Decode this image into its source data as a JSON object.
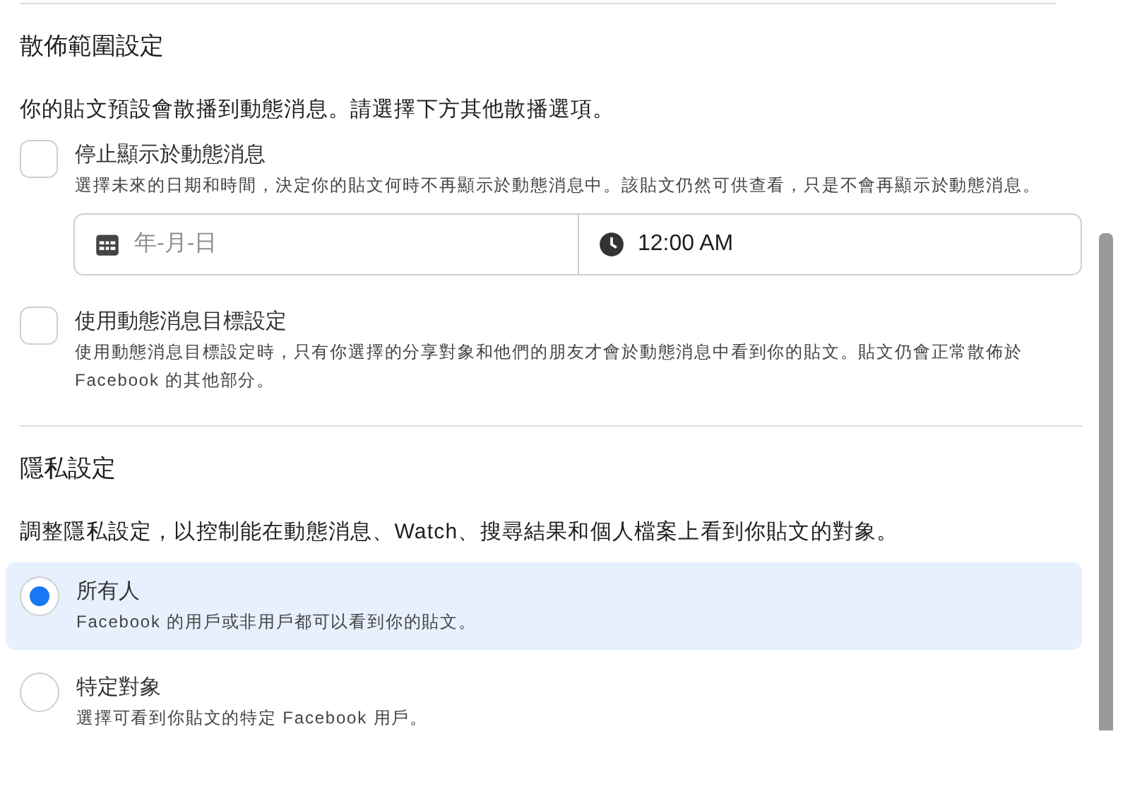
{
  "distribution": {
    "title": "散佈範圍設定",
    "description": "你的貼文預設會散播到動態消息。請選擇下方其他散播選項。",
    "options": [
      {
        "kind": "schedule",
        "label": "停止顯示於動態消息",
        "description": "選擇未來的日期和時間，決定你的貼文何時不再顯示於動態消息中。該貼文仍然可供查看，只是不會再顯示於動態消息。",
        "checked": false,
        "date_placeholder": "年-月-日",
        "time_value": "12:00 AM"
      },
      {
        "kind": "plain",
        "label": "使用動態消息目標設定",
        "description": "使用動態消息目標設定時，只有你選擇的分享對象和他們的朋友才會於動態消息中看到你的貼文。貼文仍會正常散佈於 Facebook 的其他部分。",
        "checked": false
      }
    ]
  },
  "privacy": {
    "title": "隱私設定",
    "description": "調整隱私設定，以控制能在動態消息、Watch、搜尋結果和個人檔案上看到你貼文的對象。",
    "options": [
      {
        "label": "所有人",
        "description": "Facebook 的用戶或非用戶都可以看到你的貼文。",
        "selected": true
      },
      {
        "label": "特定對象",
        "description": "選擇可看到你貼文的特定 Facebook 用戶。",
        "selected": false
      }
    ]
  }
}
